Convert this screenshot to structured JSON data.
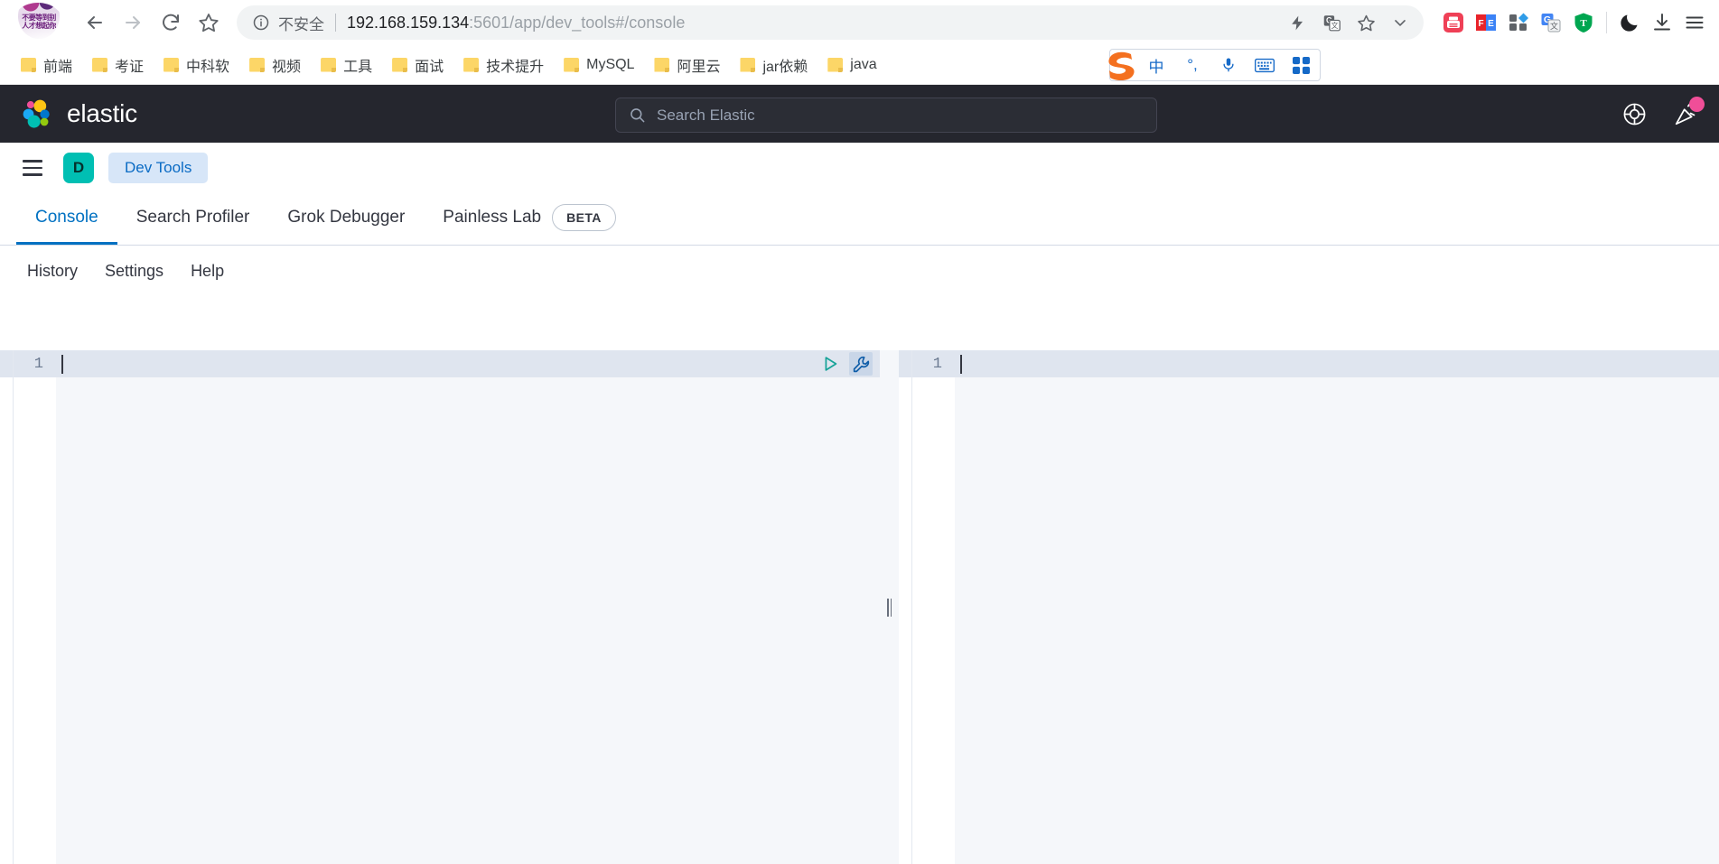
{
  "browser": {
    "avatar_text": "不要等到别人才想起你",
    "nav": {
      "back": "Back",
      "forward": "Forward",
      "reload": "Reload",
      "bookmark_star": "Bookmark this page"
    },
    "omnibox": {
      "security_label": "不安全",
      "url_host": "192.168.159.134",
      "url_rest": ":5601/app/dev_tools#/console",
      "full_url": "192.168.159.134:5601/app/dev_tools#/console"
    },
    "omnibox_actions": [
      "flash-icon",
      "translate-icon",
      "star-icon",
      "chevron-down-icon"
    ],
    "extensions": [
      {
        "name": "printer-extension",
        "label": "打印"
      },
      {
        "name": "fe-extension",
        "label": "FE"
      },
      {
        "name": "apps-grid-extension",
        "label": "Apps"
      },
      {
        "name": "google-translate-extension",
        "label": "Translate"
      },
      {
        "name": "tampermonkey-extension",
        "label": "T"
      },
      {
        "name": "dark-mode-toggle",
        "label": "Dark mode"
      },
      {
        "name": "downloads-button",
        "label": "Downloads"
      },
      {
        "name": "chrome-menu-button",
        "label": "Menu"
      }
    ],
    "bookmarks": [
      {
        "label": "前端"
      },
      {
        "label": "考证"
      },
      {
        "label": "中科软"
      },
      {
        "label": "视频"
      },
      {
        "label": "工具"
      },
      {
        "label": "面试"
      },
      {
        "label": "技术提升"
      },
      {
        "label": "MySQL"
      },
      {
        "label": "阿里云"
      },
      {
        "label": "jar依赖"
      },
      {
        "label": "java"
      }
    ],
    "ime": {
      "logo": "S",
      "items": [
        {
          "name": "chinese-mode",
          "glyph": "中"
        },
        {
          "name": "punctuation-mode",
          "glyph": "°,"
        },
        {
          "name": "voice-input",
          "glyph": "🎤"
        },
        {
          "name": "soft-keyboard",
          "glyph": "⌨"
        },
        {
          "name": "ime-toolbox",
          "glyph": "▦"
        }
      ]
    }
  },
  "kibana": {
    "brand": "elastic",
    "search": {
      "placeholder": "Search Elastic",
      "value": ""
    },
    "header_icons": [
      {
        "name": "help-icon",
        "label": "Help"
      },
      {
        "name": "announcements-icon",
        "label": "News",
        "has_badge": true
      }
    ],
    "nav": {
      "menu_label": "Toggle primary navigation",
      "space_initial": "D",
      "breadcrumb": "Dev Tools"
    },
    "tabs": [
      {
        "label": "Console",
        "active": true,
        "badge": ""
      },
      {
        "label": "Search Profiler",
        "active": false,
        "badge": ""
      },
      {
        "label": "Grok Debugger",
        "active": false,
        "badge": ""
      },
      {
        "label": "Painless Lab",
        "active": false,
        "badge": "BETA"
      }
    ],
    "subnav": [
      {
        "label": "History"
      },
      {
        "label": "Settings"
      },
      {
        "label": "Help"
      }
    ],
    "editor": {
      "request": {
        "line_number": "1",
        "content": "",
        "actions": [
          {
            "name": "send-request-button",
            "glyph": "play"
          },
          {
            "name": "wrench-menu-button",
            "glyph": "wrench"
          }
        ]
      },
      "response": {
        "line_number": "1",
        "content": ""
      }
    }
  },
  "colors": {
    "elastic_dark": "#25262e",
    "accent_blue": "#0071c2",
    "space_teal": "#00bfb3",
    "badge_pink": "#f04e98",
    "breadcrumb_bg": "#d7e6f8",
    "play_green": "#17a398",
    "wrench_blue": "#0f5da8",
    "editor_bg": "#f5f7fa",
    "gutter_active": "#dfe5ef"
  }
}
